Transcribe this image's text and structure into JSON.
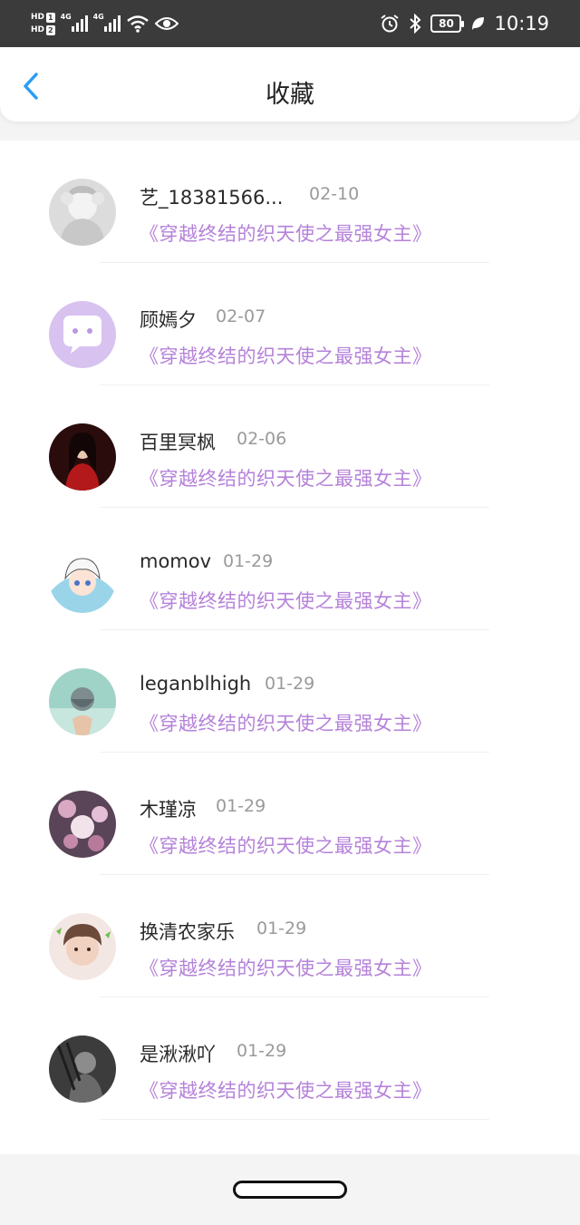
{
  "status_bar": {
    "hd1": "HD",
    "hd1_num": "1",
    "hd2": "HD",
    "hd2_num": "2",
    "network1": "4G",
    "network2": "4G",
    "battery": "80",
    "time": "10:19"
  },
  "header": {
    "title": "收藏"
  },
  "items": [
    {
      "name": "艺_18381566...",
      "date": "02-10",
      "book": "《穿越终结的织天使之最强女主》"
    },
    {
      "name": "顾嫣夕",
      "date": "02-07",
      "book": "《穿越终结的织天使之最强女主》"
    },
    {
      "name": "百里冥枫",
      "date": "02-06",
      "book": "《穿越终结的织天使之最强女主》"
    },
    {
      "name": "momov",
      "date": "01-29",
      "book": "《穿越终结的织天使之最强女主》"
    },
    {
      "name": "leganblhigh",
      "date": "01-29",
      "book": "《穿越终结的织天使之最强女主》"
    },
    {
      "name": "木瑾凉",
      "date": "01-29",
      "book": "《穿越终结的织天使之最强女主》"
    },
    {
      "name": "换清农家乐",
      "date": "01-29",
      "book": "《穿越终结的织天使之最强女主》"
    },
    {
      "name": "是湫湫吖",
      "date": "01-29",
      "book": "《穿越终结的织天使之最强女主》"
    }
  ],
  "colors": {
    "accent": "#2a9df4",
    "book_title": "#b582d9",
    "status_bar_bg": "#3b3b3b"
  }
}
